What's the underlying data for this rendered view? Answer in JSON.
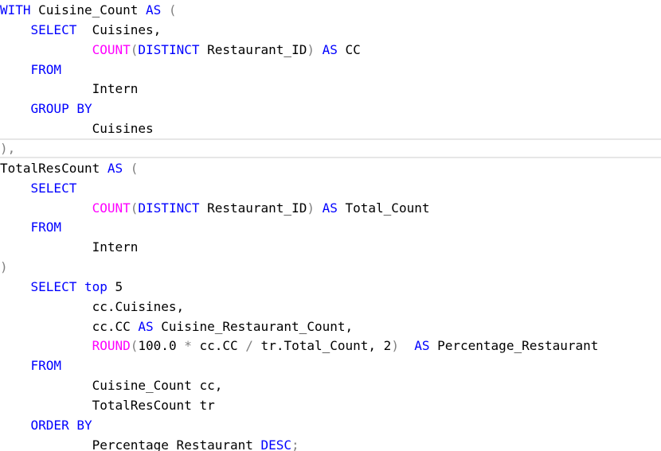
{
  "editor": {
    "lines": [
      [
        {
          "t": "WITH",
          "c": "kw"
        },
        {
          "t": " Cuisine_Count ",
          "c": "tx"
        },
        {
          "t": "AS",
          "c": "kw"
        },
        {
          "t": " (",
          "c": "gr"
        }
      ],
      [
        {
          "t": "    ",
          "c": "tx"
        },
        {
          "t": "SELECT",
          "c": "kw"
        },
        {
          "t": "  Cuisines,",
          "c": "tx"
        }
      ],
      [
        {
          "t": "            ",
          "c": "tx"
        },
        {
          "t": "COUNT",
          "c": "fn"
        },
        {
          "t": "(",
          "c": "gr"
        },
        {
          "t": "DISTINCT",
          "c": "kw"
        },
        {
          "t": " Restaurant_ID",
          "c": "tx"
        },
        {
          "t": ")",
          "c": "gr"
        },
        {
          "t": " ",
          "c": "tx"
        },
        {
          "t": "AS",
          "c": "kw"
        },
        {
          "t": " CC",
          "c": "tx"
        }
      ],
      [
        {
          "t": "    ",
          "c": "tx"
        },
        {
          "t": "FROM",
          "c": "kw"
        }
      ],
      [
        {
          "t": "            Intern",
          "c": "tx"
        }
      ],
      [
        {
          "t": "    ",
          "c": "tx"
        },
        {
          "t": "GROUP BY",
          "c": "kw"
        }
      ],
      [
        {
          "t": "            Cuisines",
          "c": "tx"
        }
      ],
      [
        {
          "t": "),",
          "c": "gr"
        }
      ],
      [
        {
          "t": "TotalResCount ",
          "c": "tx"
        },
        {
          "t": "AS",
          "c": "kw"
        },
        {
          "t": " (",
          "c": "gr"
        }
      ],
      [
        {
          "t": "    ",
          "c": "tx"
        },
        {
          "t": "SELECT",
          "c": "kw"
        }
      ],
      [
        {
          "t": "            ",
          "c": "tx"
        },
        {
          "t": "COUNT",
          "c": "fn"
        },
        {
          "t": "(",
          "c": "gr"
        },
        {
          "t": "DISTINCT",
          "c": "kw"
        },
        {
          "t": " Restaurant_ID",
          "c": "tx"
        },
        {
          "t": ")",
          "c": "gr"
        },
        {
          "t": " ",
          "c": "tx"
        },
        {
          "t": "AS",
          "c": "kw"
        },
        {
          "t": " Total_Count",
          "c": "tx"
        }
      ],
      [
        {
          "t": "    ",
          "c": "tx"
        },
        {
          "t": "FROM",
          "c": "kw"
        }
      ],
      [
        {
          "t": "            Intern",
          "c": "tx"
        }
      ],
      [
        {
          "t": ")",
          "c": "gr"
        }
      ],
      [
        {
          "t": "    ",
          "c": "tx"
        },
        {
          "t": "SELECT",
          "c": "kw"
        },
        {
          "t": " ",
          "c": "tx"
        },
        {
          "t": "top",
          "c": "kw"
        },
        {
          "t": " 5",
          "c": "tx"
        }
      ],
      [
        {
          "t": "            cc.Cuisines,",
          "c": "tx"
        }
      ],
      [
        {
          "t": "            cc.CC ",
          "c": "tx"
        },
        {
          "t": "AS",
          "c": "kw"
        },
        {
          "t": " Cuisine_Restaurant_Count,",
          "c": "tx"
        }
      ],
      [
        {
          "t": "            ",
          "c": "tx"
        },
        {
          "t": "ROUND",
          "c": "fn"
        },
        {
          "t": "(",
          "c": "gr"
        },
        {
          "t": "100.0 ",
          "c": "tx"
        },
        {
          "t": "*",
          "c": "gr"
        },
        {
          "t": " cc.CC ",
          "c": "tx"
        },
        {
          "t": "/",
          "c": "gr"
        },
        {
          "t": " tr.Total_Count, 2",
          "c": "tx"
        },
        {
          "t": ")",
          "c": "gr"
        },
        {
          "t": "  ",
          "c": "tx"
        },
        {
          "t": "AS",
          "c": "kw"
        },
        {
          "t": " Percentage_Restaurant",
          "c": "tx"
        }
      ],
      [
        {
          "t": "    ",
          "c": "tx"
        },
        {
          "t": "FROM",
          "c": "kw"
        }
      ],
      [
        {
          "t": "            Cuisine_Count cc,",
          "c": "tx"
        }
      ],
      [
        {
          "t": "            TotalResCount tr",
          "c": "tx"
        }
      ],
      [
        {
          "t": "    ",
          "c": "tx"
        },
        {
          "t": "ORDER BY",
          "c": "kw"
        }
      ],
      [
        {
          "t": "            Percentage_Restaurant ",
          "c": "tx"
        },
        {
          "t": "DESC",
          "c": "kw"
        },
        {
          "t": ";",
          "c": "gr"
        }
      ]
    ],
    "colors": {
      "keyword": "#0000ff",
      "function": "#ff00ff",
      "operator": "#808080",
      "text": "#000000",
      "separator": "#e6e6e6"
    }
  }
}
